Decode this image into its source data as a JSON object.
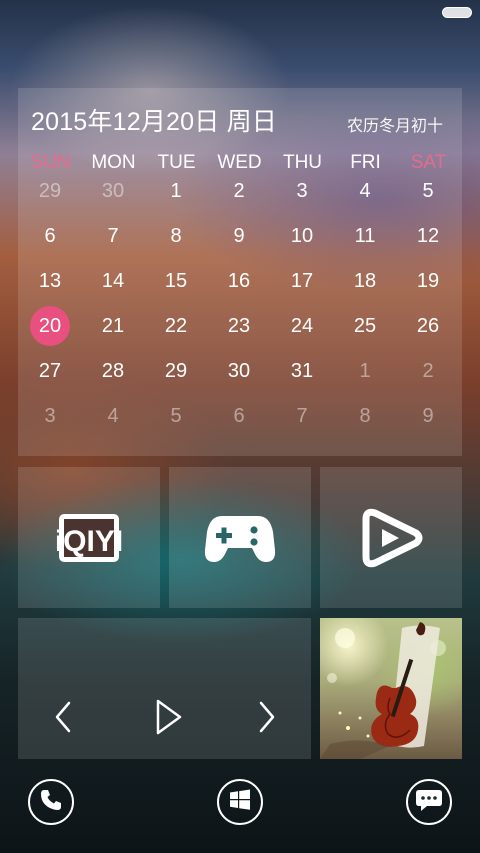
{
  "calendar": {
    "title": "2015年12月20日 周日",
    "lunar": "农历冬月初十",
    "weekdays": [
      "SUN",
      "MON",
      "TUE",
      "WED",
      "THU",
      "FRI",
      "SAT"
    ],
    "weeks": [
      [
        "29",
        "30",
        "1",
        "2",
        "3",
        "4",
        "5"
      ],
      [
        "6",
        "7",
        "8",
        "9",
        "10",
        "11",
        "12"
      ],
      [
        "13",
        "14",
        "15",
        "16",
        "17",
        "18",
        "19"
      ],
      [
        "20",
        "21",
        "22",
        "23",
        "24",
        "25",
        "26"
      ],
      [
        "27",
        "28",
        "29",
        "30",
        "31",
        "1",
        "2"
      ],
      [
        "3",
        "4",
        "5",
        "6",
        "7",
        "8",
        "9"
      ]
    ],
    "today": "20",
    "weekend_color": "#e86a8c",
    "today_color": "#e8507f"
  },
  "tiles": {
    "app1_icon": "iqiyi-logo-icon",
    "app1_logo_text": "iQIYI",
    "app2_icon": "gamepad-icon",
    "app3_icon": "video-play-icon"
  },
  "music": {
    "prev_icon": "chevron-left-icon",
    "play_icon": "play-icon",
    "next_icon": "chevron-right-icon"
  },
  "dock": {
    "phone_icon": "phone-icon",
    "windows_icon": "windows-logo-icon",
    "messages_icon": "chat-bubble-icon"
  }
}
